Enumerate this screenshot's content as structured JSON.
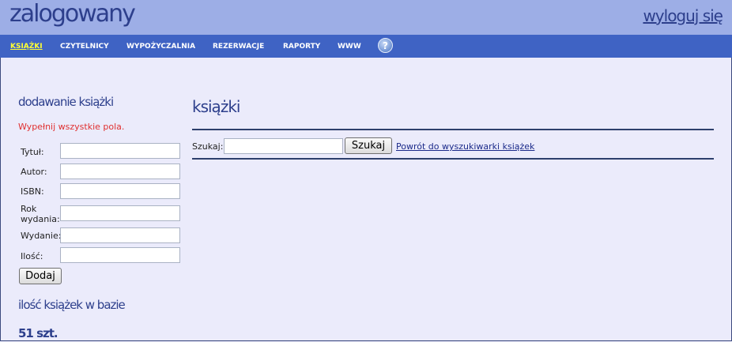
{
  "header": {
    "title": "zalogowany",
    "logout_label": "wyloguj się"
  },
  "nav": {
    "items": [
      "KSIĄŻKI",
      "CZYTELNICY",
      "WYPOŻYCZALNIA",
      "REZERWACJE",
      "RAPORTY",
      "WWW"
    ],
    "active_index": 0,
    "help_glyph": "?"
  },
  "sidebar": {
    "form_title": "dodawanie książki",
    "error_message": "Wypełnij wszystkie pola.",
    "fields": [
      {
        "label": "Tytuł:",
        "value": ""
      },
      {
        "label": "Autor:",
        "value": ""
      },
      {
        "label": "ISBN:",
        "value": ""
      },
      {
        "label": "Rok wydania:",
        "value": ""
      },
      {
        "label": "Wydanie:",
        "value": ""
      },
      {
        "label": "Ilość:",
        "value": ""
      }
    ],
    "submit_label": "Dodaj",
    "count_title": "ilość książek w bazie",
    "count_value": "51 szt."
  },
  "main": {
    "title": "książki",
    "search_label": "Szukaj:",
    "search_value": "",
    "search_button": "Szukaj",
    "back_link": "Powrót do wyszukiwarki książek"
  },
  "colors": {
    "header_bg": "#9daee6",
    "nav_bg": "#3f63c4",
    "page_bg": "#ebebfb",
    "accent_text": "#2d3f8c",
    "active_nav": "#ffff33",
    "error": "#e03030"
  }
}
